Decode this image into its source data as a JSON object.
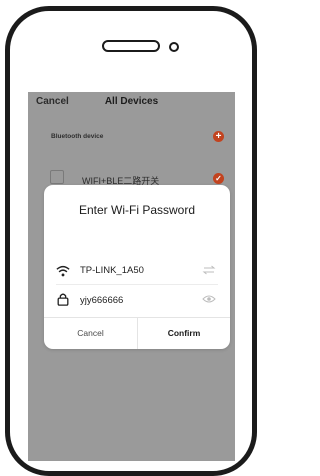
{
  "app": {
    "nav": {
      "cancel_label": "Cancel",
      "title": "All Devices"
    },
    "section_label": "Bluetooth device",
    "add_icon": "plus-icon",
    "device": {
      "name": "WIFI+BLE二路开关",
      "icon": "device-icon",
      "selected_icon": "check-icon"
    }
  },
  "dialog": {
    "title": "Enter Wi-Fi Password",
    "wifi": {
      "icon": "wifi-icon",
      "ssid": "TP-LINK_1A50",
      "action_icon": "swap-icon"
    },
    "password": {
      "icon": "lock-icon",
      "value": "yjy666666",
      "action_icon": "eye-icon"
    },
    "cancel_label": "Cancel",
    "confirm_label": "Confirm"
  },
  "colors": {
    "accent": "#c2431f",
    "overlay": "#9a9a9a"
  }
}
